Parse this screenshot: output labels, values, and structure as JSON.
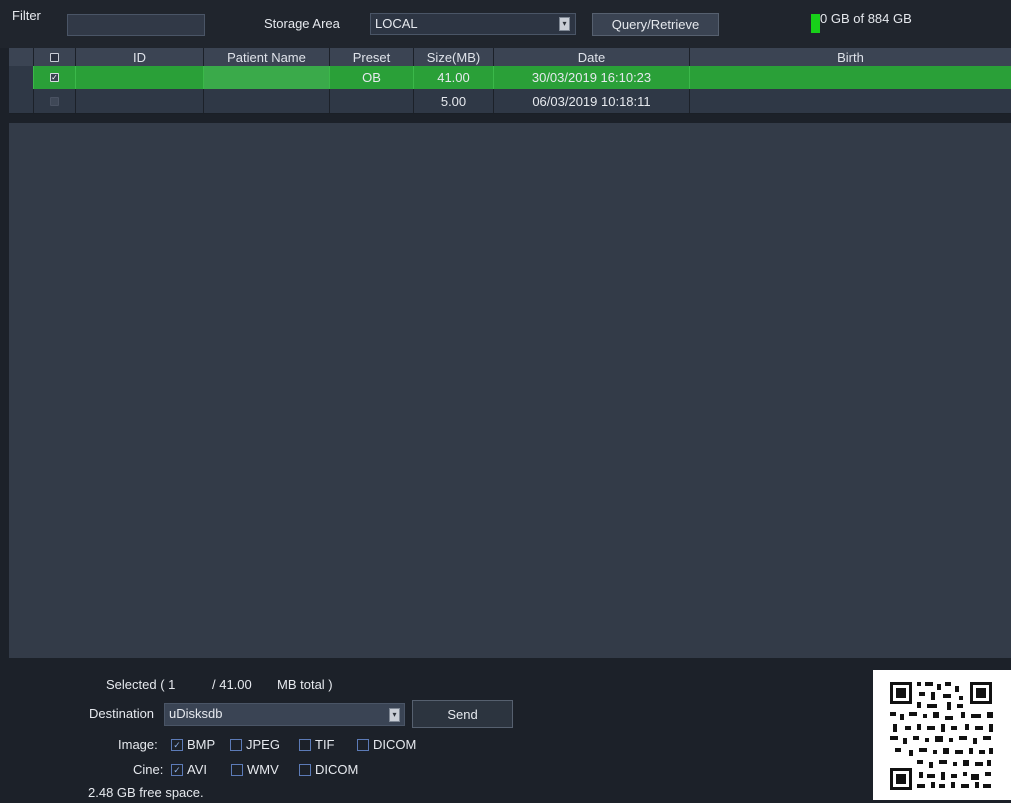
{
  "topbar": {
    "filter_label": "Filter",
    "filter_value": "",
    "storage_area_label": "Storage Area",
    "storage_area_value": "LOCAL",
    "query_button": "Query/Retrieve",
    "storage_text": "50 GB of 884 GB",
    "storage_text_visible": "0 GB of 884 GB",
    "storage_indicator_color": "#18d019"
  },
  "table": {
    "headers": [
      "ID",
      "Patient Name",
      "Preset",
      "Size(MB)",
      "Date",
      "Birth"
    ],
    "rows": [
      {
        "checked": true,
        "id": "",
        "patient_name": "",
        "preset": "OB",
        "size": "41.00",
        "date": "30/03/2019 16:10:23",
        "birth": ""
      },
      {
        "checked": false,
        "id": "",
        "patient_name": "",
        "preset": "",
        "size": "5.00",
        "date": "06/03/2019 10:18:11",
        "birth": ""
      }
    ],
    "selected_row_color": "#2aa038"
  },
  "bottom": {
    "selected_prefix": "Selected ( 1",
    "selected_total": "/ 41.00",
    "selected_suffix": "MB total )",
    "destination_label": "Destination",
    "destination_value": "uDisksdb",
    "send_button": "Send",
    "image_label": "Image:",
    "image_options": [
      {
        "label": "BMP",
        "checked": true
      },
      {
        "label": "JPEG",
        "checked": false
      },
      {
        "label": "TIF",
        "checked": false
      },
      {
        "label": "DICOM",
        "checked": false
      }
    ],
    "cine_label": "Cine:",
    "cine_options": [
      {
        "label": "AVI",
        "checked": true
      },
      {
        "label": "WMV",
        "checked": false
      },
      {
        "label": "DICOM",
        "checked": false
      }
    ],
    "free_space": "2.48 GB free space."
  },
  "icons": {
    "dropdown": "chevron-down-icon",
    "check": "checkmark-icon",
    "qr": "qr-code-icon"
  }
}
